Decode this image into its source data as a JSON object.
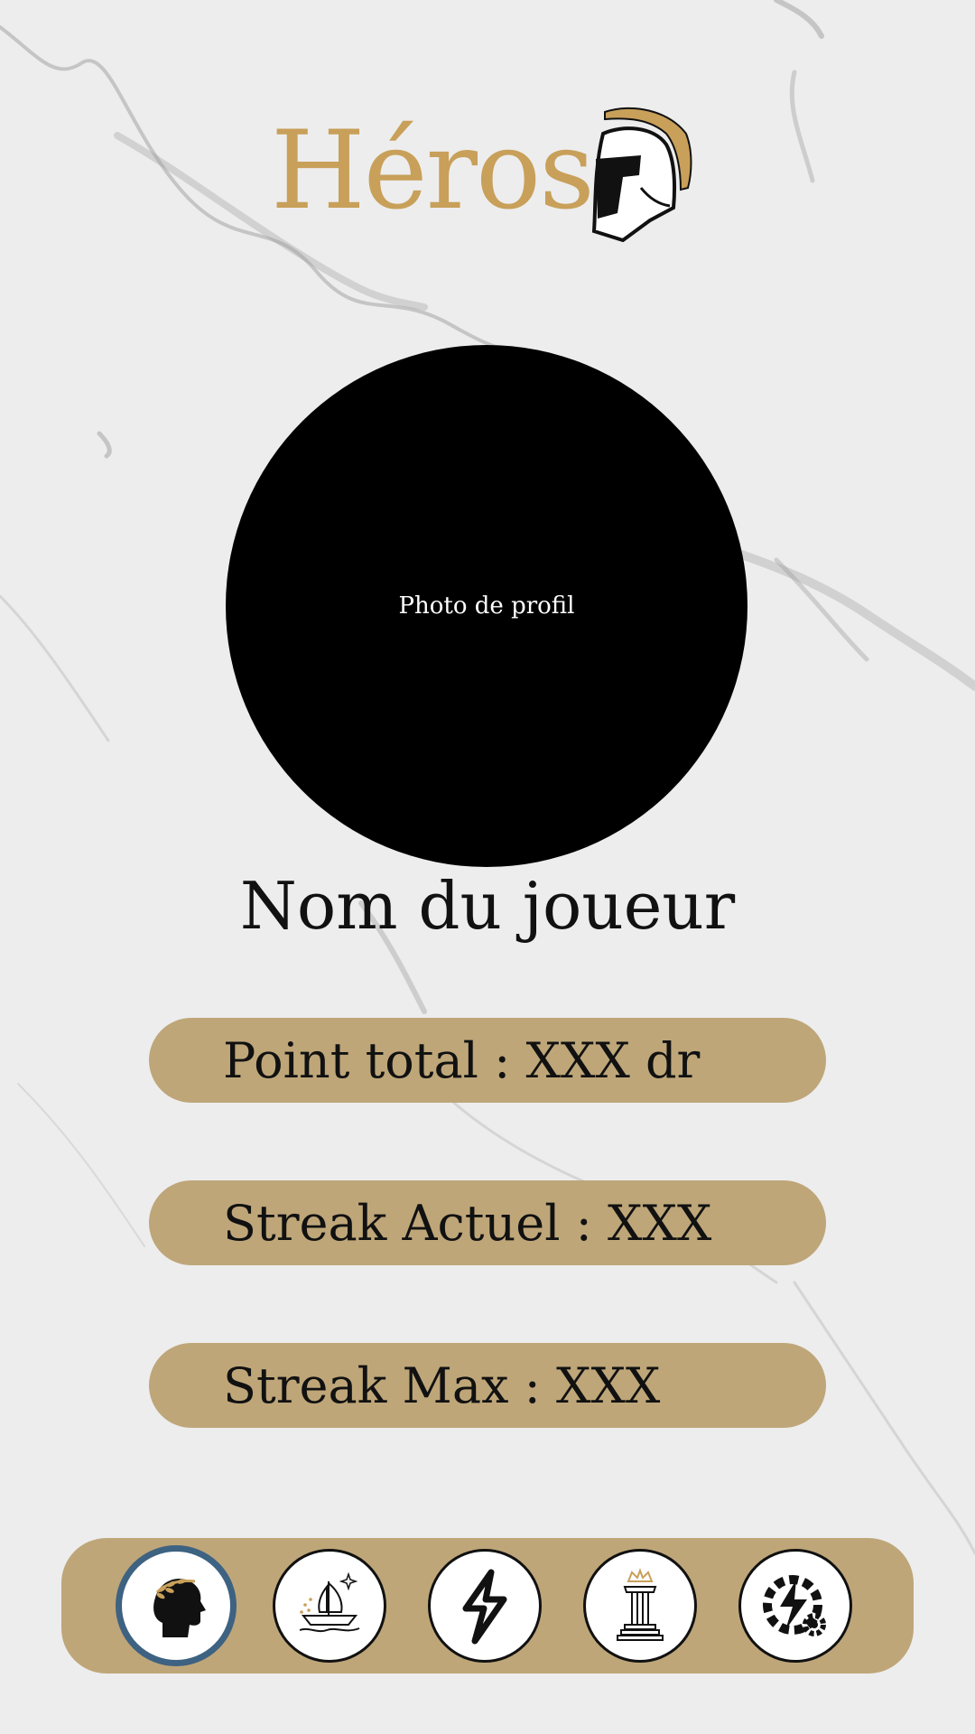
{
  "header": {
    "title": "Héros",
    "logo_icon": "spartan-helmet-icon"
  },
  "profile": {
    "photo_label": "Photo de profil",
    "player_name": "Nom du joueur"
  },
  "stats": [
    {
      "label": "Point total : XXX dr"
    },
    {
      "label": "Streak Actuel : XXX"
    },
    {
      "label": "Streak Max : XXX"
    }
  ],
  "nav": {
    "items": [
      {
        "icon": "laurel-head-icon",
        "active": true
      },
      {
        "icon": "greek-ship-icon",
        "active": false
      },
      {
        "icon": "lightning-icon",
        "active": false
      },
      {
        "icon": "column-crown-icon",
        "active": false
      },
      {
        "icon": "lightning-gear-icon",
        "active": false
      }
    ]
  },
  "colors": {
    "gold": "#c8a05a",
    "pill": "#bea679",
    "active_ring": "#3e6281",
    "background": "#ececec"
  }
}
